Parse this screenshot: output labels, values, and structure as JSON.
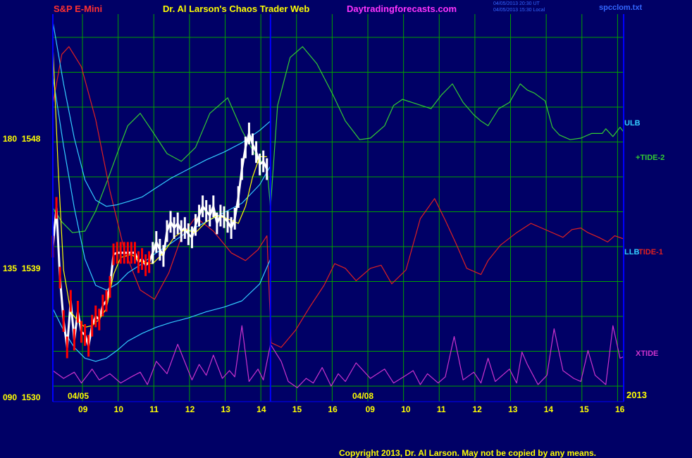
{
  "header": {
    "instrument": "S&P E-Mini",
    "title": "Dr. Al Larson's Chaos Trader Web",
    "site": "Daytradingforecasts.com",
    "timestamp_ut": "04/05/2013 20:30 UT",
    "timestamp_local": "04/05/2013 15:30 Local",
    "file": "spcclom.txt"
  },
  "footer": {
    "copyright": "Copyright 2013, Dr. Al Larson. May not be copied by any means."
  },
  "colors": {
    "background": "#000066",
    "grid": "#00a000",
    "axis": "#0000ff",
    "tide2": "#33cc33",
    "tide1": "#e02020",
    "xtide": "#cc33cc",
    "bands": "#33ccff",
    "price": "#ffffff",
    "price_early": "#ff0000",
    "fast_ma": "#ffff00"
  },
  "chart_data": {
    "type": "line",
    "y_ticks": [
      {
        "label": "180  1548",
        "value": 1548
      },
      {
        "label": "135  1539",
        "value": 1539
      },
      {
        "label": "090  1530",
        "value": 1530
      }
    ],
    "ylim": [
      1530,
      1555
    ],
    "x_ticks_left": [
      "09",
      "10",
      "11",
      "12",
      "13",
      "14",
      "15",
      "16"
    ],
    "x_ticks_right": [
      "09",
      "10",
      "11",
      "12",
      "13",
      "14",
      "15",
      "16"
    ],
    "date_left": "04/05",
    "date_right": "04/08",
    "year": "2013",
    "series_labels": [
      {
        "name": "ULB",
        "color": "#33ccff"
      },
      {
        "name": "+TIDE-2",
        "color": "#33cc33"
      },
      {
        "name": "LLB",
        "color": "#33ccff"
      },
      {
        "name": "TIDE-1",
        "color": "#e02020"
      },
      {
        "name": "XTIDE",
        "color": "#cc33cc"
      }
    ],
    "series": [
      {
        "name": "+TIDE-2",
        "x": [
          0,
          0.25,
          0.55,
          0.9,
          1.2,
          1.55,
          1.85,
          2.1,
          2.45,
          2.8,
          3.2,
          3.6,
          4.0,
          4.4,
          4.9,
          5.3,
          5.7,
          6.0,
          6.1,
          6.3,
          6.65,
          7.0,
          7.4,
          7.85,
          8.2,
          8.6,
          8.9,
          9.3,
          9.55,
          9.8,
          10.2,
          10.6,
          10.9,
          11.2,
          11.5,
          11.8,
          12.0,
          12.2,
          12.5,
          12.8,
          13.1,
          13.3,
          13.5,
          13.8,
          14.0,
          14.2,
          14.5,
          14.8,
          15.1,
          15.4,
          15.5,
          15.7,
          15.9,
          16.0
        ],
        "y": [
          1542.5,
          1541.6,
          1540.9,
          1541.0,
          1542.3,
          1544.4,
          1546.3,
          1547.8,
          1548.6,
          1547.4,
          1546.0,
          1545.5,
          1546.4,
          1548.6,
          1549.6,
          1547.5,
          1545.8,
          1545.2,
          1542.5,
          1549.1,
          1552.2,
          1552.9,
          1551.8,
          1549.8,
          1548.1,
          1546.9,
          1547.0,
          1547.8,
          1549.1,
          1549.5,
          1549.2,
          1548.9,
          1549.8,
          1550.5,
          1549.3,
          1548.5,
          1548.1,
          1547.8,
          1548.9,
          1549.3,
          1550.5,
          1550.1,
          1549.9,
          1549.4,
          1547.7,
          1547.2,
          1546.9,
          1547.0,
          1547.3,
          1547.3,
          1547.6,
          1547.1,
          1547.7,
          1547.4
        ]
      },
      {
        "name": "TIDE-1",
        "x": [
          0,
          0.25,
          0.45,
          0.8,
          1.2,
          1.6,
          2.0,
          2.45,
          2.85,
          3.25,
          3.6,
          4.0,
          4.5,
          5.0,
          5.4,
          5.75,
          6.0,
          6.12,
          6.4,
          6.8,
          7.2,
          7.6,
          7.9,
          8.2,
          8.5,
          8.9,
          9.2,
          9.5,
          9.9,
          10.3,
          10.7,
          11.0,
          11.3,
          11.6,
          12.0,
          12.2,
          12.55,
          13.0,
          13.4,
          13.9,
          14.3,
          14.55,
          14.8,
          15.0,
          15.3,
          15.55,
          15.75,
          16.0
        ],
        "y": [
          1549.2,
          1552.4,
          1552.9,
          1551.6,
          1548.2,
          1543.6,
          1539.8,
          1537.2,
          1536.6,
          1538.3,
          1540.6,
          1541.9,
          1541.0,
          1539.6,
          1539.1,
          1539.8,
          1540.7,
          1533.8,
          1533.5,
          1534.6,
          1536.1,
          1537.5,
          1538.9,
          1538.6,
          1537.8,
          1538.6,
          1538.8,
          1537.6,
          1538.5,
          1541.8,
          1543.1,
          1541.7,
          1540.2,
          1538.6,
          1538.2,
          1539.1,
          1540.1,
          1540.9,
          1541.5,
          1541.0,
          1540.6,
          1541.1,
          1541.2,
          1540.9,
          1540.6,
          1540.3,
          1540.7,
          1540.5
        ]
      },
      {
        "name": "XTIDE",
        "x": [
          0,
          0.3,
          0.6,
          0.8,
          1.1,
          1.3,
          1.6,
          1.9,
          2.2,
          2.45,
          2.65,
          2.9,
          3.2,
          3.5,
          3.9,
          4.1,
          4.3,
          4.5,
          4.75,
          4.95,
          5.1,
          5.3,
          5.5,
          5.75,
          5.9,
          6.1,
          6.4,
          6.6,
          6.85,
          7.1,
          7.3,
          7.55,
          7.8,
          8.0,
          8.2,
          8.5,
          8.9,
          9.3,
          9.55,
          9.9,
          10.1,
          10.3,
          10.5,
          10.8,
          11.0,
          11.25,
          11.5,
          11.8,
          12.0,
          12.2,
          12.4,
          12.8,
          13.0,
          13.15,
          13.3,
          13.6,
          13.85,
          14.05,
          14.3,
          14.6,
          14.8,
          15.0,
          15.2,
          15.5,
          15.7,
          15.9,
          16.0
        ],
        "y": [
          1532.0,
          1531.5,
          1531.9,
          1531.2,
          1532.1,
          1531.4,
          1531.8,
          1531.2,
          1531.6,
          1531.9,
          1531.1,
          1532.6,
          1531.8,
          1533.7,
          1531.4,
          1532.4,
          1531.7,
          1533.0,
          1531.5,
          1532.0,
          1531.6,
          1534.9,
          1531.3,
          1532.1,
          1531.4,
          1533.7,
          1532.6,
          1531.3,
          1530.9,
          1531.5,
          1531.2,
          1532.2,
          1531.0,
          1531.8,
          1531.3,
          1532.5,
          1531.5,
          1532.1,
          1531.2,
          1531.7,
          1532.0,
          1531.1,
          1531.8,
          1531.2,
          1531.6,
          1534.2,
          1531.4,
          1531.9,
          1531.2,
          1532.8,
          1531.3,
          1532.1,
          1531.2,
          1533.2,
          1532.4,
          1531.1,
          1531.7,
          1534.7,
          1532.0,
          1531.5,
          1531.3,
          1533.3,
          1531.7,
          1531.1,
          1534.9,
          1532.8,
          1532.9
        ]
      },
      {
        "name": "ULB",
        "x": [
          0,
          0.3,
          0.6,
          0.9,
          1.2,
          1.5,
          1.8,
          2.1,
          2.5,
          2.9,
          3.3,
          3.8,
          4.3,
          4.8,
          5.3,
          5.8,
          6.1
        ],
        "y": [
          1554.5,
          1550.5,
          1547.0,
          1544.3,
          1543.0,
          1542.6,
          1542.7,
          1542.9,
          1543.2,
          1543.8,
          1544.4,
          1545.0,
          1545.6,
          1546.1,
          1546.7,
          1547.5,
          1548.1
        ]
      },
      {
        "name": "ULB-inner",
        "x": [
          0,
          0.3,
          0.6,
          0.9,
          1.2,
          1.5,
          1.8,
          2.1,
          2.5,
          2.9,
          3.3,
          3.8,
          4.3,
          4.8,
          5.3,
          5.8,
          6.1
        ],
        "y": [
          1551.0,
          1546.5,
          1542.5,
          1539.2,
          1537.5,
          1537.2,
          1537.6,
          1538.3,
          1538.9,
          1539.6,
          1540.2,
          1541.0,
          1541.6,
          1542.2,
          1542.8,
          1544.0,
          1545.2
        ]
      },
      {
        "name": "LLB",
        "x": [
          0,
          0.3,
          0.6,
          0.9,
          1.2,
          1.5,
          1.8,
          2.1,
          2.5,
          2.9,
          3.3,
          3.8,
          4.3,
          4.8,
          5.3,
          5.8,
          6.1
        ],
        "y": [
          1536.0,
          1534.6,
          1533.5,
          1532.8,
          1532.6,
          1532.8,
          1533.3,
          1533.9,
          1534.4,
          1534.8,
          1535.1,
          1535.4,
          1535.8,
          1536.1,
          1536.5,
          1537.6,
          1539.2
        ]
      },
      {
        "name": "Price",
        "x": [
          0.0,
          0.1,
          0.2,
          0.3,
          0.4,
          0.5,
          0.6,
          0.7,
          0.8,
          0.9,
          1.0,
          1.1,
          1.2,
          1.3,
          1.4,
          1.5,
          1.6,
          1.7,
          1.8,
          1.9,
          2.0,
          2.1,
          2.2,
          2.3,
          2.4,
          2.5,
          2.6,
          2.7,
          2.8,
          2.9,
          3.0,
          3.1,
          3.2,
          3.3,
          3.4,
          3.5,
          3.6,
          3.7,
          3.8,
          3.9,
          4.0,
          4.1,
          4.2,
          4.3,
          4.4,
          4.5,
          4.6,
          4.7,
          4.8,
          4.9,
          5.0,
          5.1,
          5.2,
          5.3,
          5.4,
          5.5,
          5.6,
          5.7,
          5.8,
          5.9,
          6.0
        ],
        "y": [
          1540.0,
          1542.5,
          1538.0,
          1535.2,
          1533.5,
          1536.5,
          1534.0,
          1535.8,
          1534.5,
          1534.3,
          1533.6,
          1534.9,
          1535.5,
          1535.3,
          1536.2,
          1536.5,
          1537.4,
          1539.5,
          1539.6,
          1539.6,
          1539.6,
          1539.6,
          1539.6,
          1539.6,
          1539.0,
          1539.2,
          1538.8,
          1539.0,
          1539.6,
          1540.3,
          1539.8,
          1539.4,
          1541.0,
          1541.6,
          1541.2,
          1541.5,
          1541.0,
          1541.2,
          1540.8,
          1540.6,
          1541.4,
          1542.0,
          1542.6,
          1542.3,
          1542.0,
          1542.6,
          1541.5,
          1542.0,
          1541.9,
          1541.6,
          1541.2,
          1541.8,
          1543.2,
          1545.0,
          1546.4,
          1547.3,
          1546.6,
          1546.1,
          1545.3,
          1545.5,
          1545.0
        ]
      },
      {
        "name": "MA",
        "x": [
          0.0,
          0.15,
          0.3,
          0.5,
          0.7,
          0.9,
          1.1,
          1.3,
          1.5,
          1.7,
          1.9,
          2.2,
          2.5,
          2.8,
          3.1,
          3.4,
          3.7,
          4.0,
          4.3,
          4.6,
          4.9,
          5.2,
          5.4,
          5.6,
          5.8,
          6.0
        ],
        "y": [
          1553.0,
          1545.0,
          1538.5,
          1535.8,
          1535.2,
          1534.8,
          1534.9,
          1535.3,
          1536.0,
          1538.2,
          1539.3,
          1539.5,
          1539.0,
          1538.9,
          1539.6,
          1540.6,
          1541.1,
          1540.9,
          1541.6,
          1542.0,
          1541.8,
          1541.5,
          1542.6,
          1544.5,
          1545.8,
          1545.8
        ]
      }
    ],
    "grid": true
  }
}
